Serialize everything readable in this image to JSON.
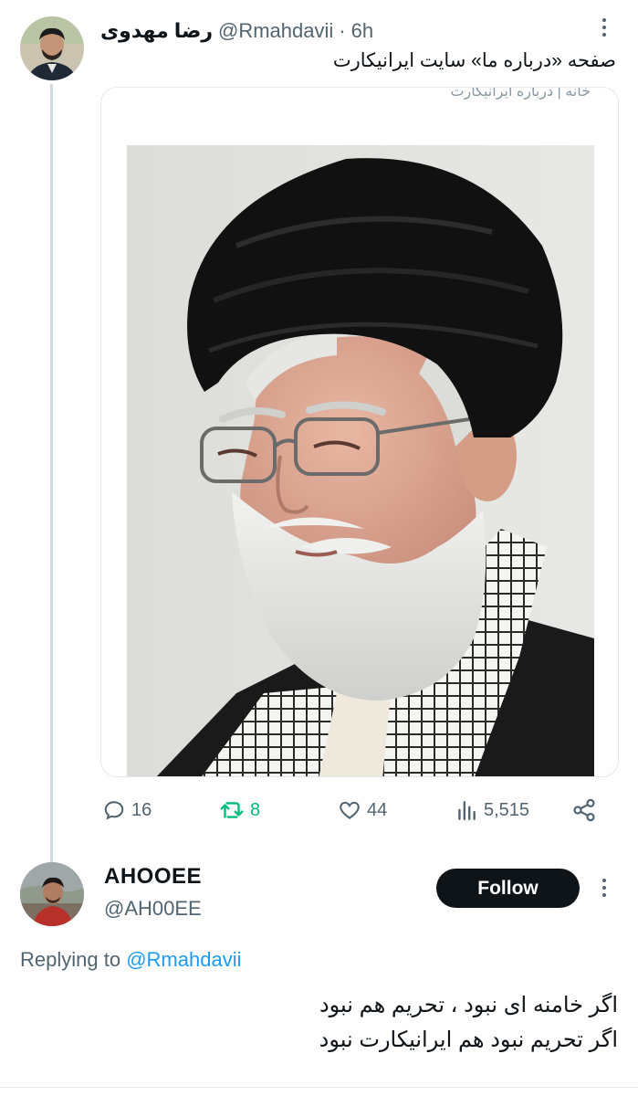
{
  "tweet": {
    "author_name": "رضا مهدوی",
    "handle": "@Rmahdavii",
    "separator": "·",
    "time": "6h",
    "text": "صفحه «درباره ما» سایت ایرانیکارت",
    "media": {
      "top_crop_text": "خانه  |  درباره ایرانیکارت"
    },
    "actions": {
      "replies": "16",
      "retweets": "8",
      "likes": "44",
      "views": "5,515"
    }
  },
  "reply": {
    "author_name": "AHOOEE",
    "handle": "@AH00EE",
    "follow_label": "Follow",
    "replying_prefix": "Replying to",
    "replying_to": "@Rmahdavii",
    "text_line1": "اگر خامنه ای نبود ، تحریم هم نبود",
    "text_line2": "اگر تحریم نبود هم ایرانیکارت نبود"
  },
  "colors": {
    "text_primary": "#0f1419",
    "text_secondary": "#536471",
    "link": "#1d9bf0",
    "retweet_green": "#00ba7c",
    "thread_line": "#cfd9de",
    "follow_button_bg": "#0f1419"
  },
  "icons": [
    "more-icon",
    "reply-icon",
    "retweet-icon",
    "like-icon",
    "views-icon",
    "share-icon"
  ]
}
